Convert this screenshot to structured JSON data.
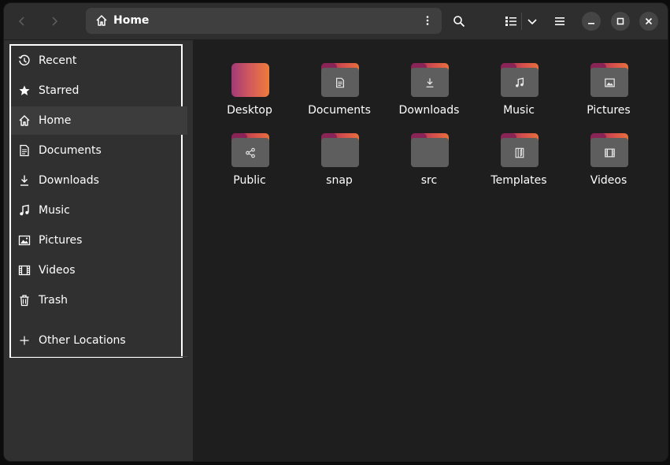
{
  "header": {
    "path_label": "Home",
    "icons": {
      "back": "chevron-left-icon",
      "forward": "chevron-right-icon",
      "home": "home-icon",
      "path_menu": "vertical-dots-icon",
      "search": "search-icon",
      "view": "list-view-icon",
      "view_dropdown": "chevron-down-icon",
      "menu": "hamburger-icon",
      "minimize": "minimize-icon",
      "maximize": "maximize-icon",
      "close": "close-icon"
    }
  },
  "sidebar": {
    "items": [
      {
        "label": "Recent",
        "icon": "clock-icon"
      },
      {
        "label": "Starred",
        "icon": "star-icon"
      },
      {
        "label": "Home",
        "icon": "home-icon",
        "active": true
      },
      {
        "label": "Documents",
        "icon": "document-icon"
      },
      {
        "label": "Downloads",
        "icon": "download-icon"
      },
      {
        "label": "Music",
        "icon": "music-icon"
      },
      {
        "label": "Pictures",
        "icon": "picture-icon"
      },
      {
        "label": "Videos",
        "icon": "video-icon"
      },
      {
        "label": "Trash",
        "icon": "trash-icon"
      }
    ],
    "other_locations": {
      "label": "Other Locations",
      "icon": "plus-icon"
    }
  },
  "main": {
    "folders": [
      {
        "label": "Desktop",
        "icon": "desktop-folder-icon"
      },
      {
        "label": "Documents",
        "icon": "documents-folder-icon"
      },
      {
        "label": "Downloads",
        "icon": "downloads-folder-icon"
      },
      {
        "label": "Music",
        "icon": "music-folder-icon"
      },
      {
        "label": "Pictures",
        "icon": "pictures-folder-icon"
      },
      {
        "label": "Public",
        "icon": "public-folder-icon"
      },
      {
        "label": "snap",
        "icon": "folder-icon"
      },
      {
        "label": "src",
        "icon": "folder-icon"
      },
      {
        "label": "Templates",
        "icon": "templates-folder-icon"
      },
      {
        "label": "Videos",
        "icon": "videos-folder-icon"
      }
    ]
  },
  "colors": {
    "window_bg": "#2a2a2a",
    "sidebar_bg": "#303030",
    "content_bg": "#1e1e1e",
    "folder_grey": "#5e5e5e",
    "folder_tab_gradient_start": "#8b2456",
    "folder_tab_gradient_end": "#e8703a",
    "highlight_frame": "#ffffff"
  }
}
